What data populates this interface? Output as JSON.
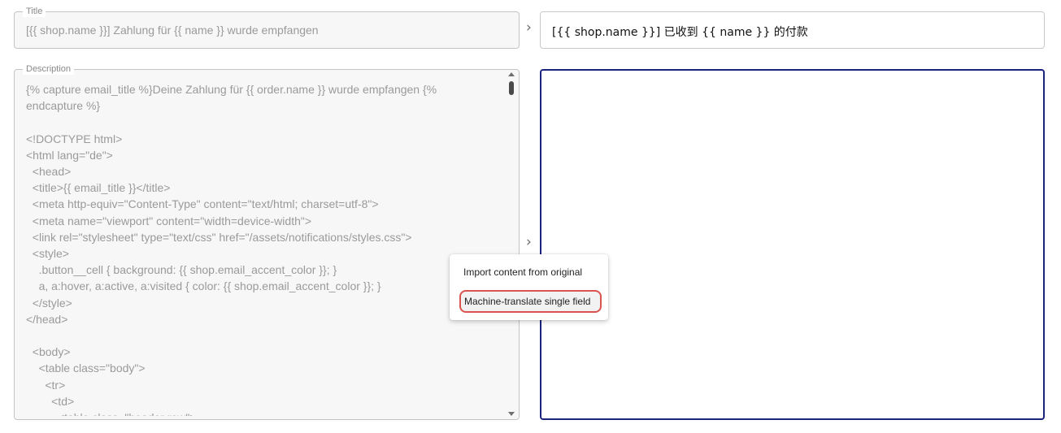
{
  "source": {
    "title": {
      "legend": "Title",
      "value": "[{{ shop.name }}] Zahlung für {{ name }} wurde empfangen"
    },
    "description": {
      "legend": "Description",
      "value": "{% capture email_title %}Deine Zahlung für {{ order.name }} wurde empfangen {%\nendcapture %}\n\n<!DOCTYPE html>\n<html lang=\"de\">\n  <head>\n  <title>{{ email_title }}</title>\n  <meta http-equiv=\"Content-Type\" content=\"text/html; charset=utf-8\">\n  <meta name=\"viewport\" content=\"width=device-width\">\n  <link rel=\"stylesheet\" type=\"text/css\" href=\"/assets/notifications/styles.css\">\n  <style>\n    .button__cell { background: {{ shop.email_accent_color }}; }\n    a, a:hover, a:active, a:visited { color: {{ shop.email_accent_color }}; }\n  </style>\n</head>\n\n  <body>\n    <table class=\"body\">\n      <tr>\n        <td>\n          <table class=\"header row\">"
    }
  },
  "target": {
    "title": {
      "value": "[{{ shop.name }}] 已收到 {{ name }} 的付款"
    },
    "description": {
      "value": ""
    }
  },
  "chevron_glyph": "›",
  "context_menu": {
    "items": [
      {
        "label": "Import content from original"
      },
      {
        "label": "Machine-translate single field"
      }
    ]
  },
  "colors": {
    "focus_border": "#1a237e",
    "highlight_border": "#d9534f"
  },
  "icons": [
    "chevron-right-icon",
    "scroll-up-arrow-icon",
    "scroll-down-arrow-icon"
  ]
}
